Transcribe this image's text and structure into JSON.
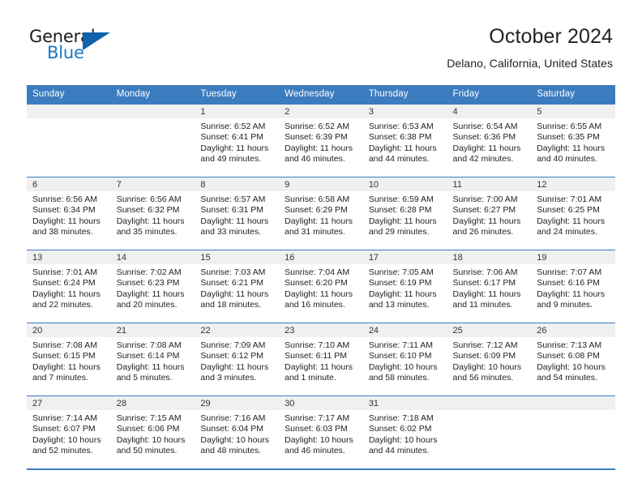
{
  "brand": {
    "name_top": "General",
    "name_bottom": "Blue",
    "color_dark": "#1b1b1b",
    "color_blue": "#1878c4",
    "triangle_color": "#1163ab"
  },
  "header": {
    "title": "October 2024",
    "subtitle": "Delano, California, United States"
  },
  "theme": {
    "header_bg": "#3b7cbf",
    "header_text": "#ffffff",
    "daynum_bg": "#f0f0f0",
    "cell_bg": "#ffffff",
    "body_text": "#1f1f1f"
  },
  "calendar": {
    "weekday_headers": [
      "Sunday",
      "Monday",
      "Tuesday",
      "Wednesday",
      "Thursday",
      "Friday",
      "Saturday"
    ],
    "labels": {
      "sunrise_prefix": "Sunrise:",
      "sunset_prefix": "Sunset:",
      "daylight_prefix": "Daylight:"
    },
    "weeks": [
      [
        {
          "empty": true
        },
        {
          "empty": true
        },
        {
          "day": "1",
          "sunrise": "Sunrise: 6:52 AM",
          "sunset": "Sunset: 6:41 PM",
          "daylight": "Daylight: 11 hours and 49 minutes."
        },
        {
          "day": "2",
          "sunrise": "Sunrise: 6:52 AM",
          "sunset": "Sunset: 6:39 PM",
          "daylight": "Daylight: 11 hours and 46 minutes."
        },
        {
          "day": "3",
          "sunrise": "Sunrise: 6:53 AM",
          "sunset": "Sunset: 6:38 PM",
          "daylight": "Daylight: 11 hours and 44 minutes."
        },
        {
          "day": "4",
          "sunrise": "Sunrise: 6:54 AM",
          "sunset": "Sunset: 6:36 PM",
          "daylight": "Daylight: 11 hours and 42 minutes."
        },
        {
          "day": "5",
          "sunrise": "Sunrise: 6:55 AM",
          "sunset": "Sunset: 6:35 PM",
          "daylight": "Daylight: 11 hours and 40 minutes."
        }
      ],
      [
        {
          "day": "6",
          "sunrise": "Sunrise: 6:56 AM",
          "sunset": "Sunset: 6:34 PM",
          "daylight": "Daylight: 11 hours and 38 minutes."
        },
        {
          "day": "7",
          "sunrise": "Sunrise: 6:56 AM",
          "sunset": "Sunset: 6:32 PM",
          "daylight": "Daylight: 11 hours and 35 minutes."
        },
        {
          "day": "8",
          "sunrise": "Sunrise: 6:57 AM",
          "sunset": "Sunset: 6:31 PM",
          "daylight": "Daylight: 11 hours and 33 minutes."
        },
        {
          "day": "9",
          "sunrise": "Sunrise: 6:58 AM",
          "sunset": "Sunset: 6:29 PM",
          "daylight": "Daylight: 11 hours and 31 minutes."
        },
        {
          "day": "10",
          "sunrise": "Sunrise: 6:59 AM",
          "sunset": "Sunset: 6:28 PM",
          "daylight": "Daylight: 11 hours and 29 minutes."
        },
        {
          "day": "11",
          "sunrise": "Sunrise: 7:00 AM",
          "sunset": "Sunset: 6:27 PM",
          "daylight": "Daylight: 11 hours and 26 minutes."
        },
        {
          "day": "12",
          "sunrise": "Sunrise: 7:01 AM",
          "sunset": "Sunset: 6:25 PM",
          "daylight": "Daylight: 11 hours and 24 minutes."
        }
      ],
      [
        {
          "day": "13",
          "sunrise": "Sunrise: 7:01 AM",
          "sunset": "Sunset: 6:24 PM",
          "daylight": "Daylight: 11 hours and 22 minutes."
        },
        {
          "day": "14",
          "sunrise": "Sunrise: 7:02 AM",
          "sunset": "Sunset: 6:23 PM",
          "daylight": "Daylight: 11 hours and 20 minutes."
        },
        {
          "day": "15",
          "sunrise": "Sunrise: 7:03 AM",
          "sunset": "Sunset: 6:21 PM",
          "daylight": "Daylight: 11 hours and 18 minutes."
        },
        {
          "day": "16",
          "sunrise": "Sunrise: 7:04 AM",
          "sunset": "Sunset: 6:20 PM",
          "daylight": "Daylight: 11 hours and 16 minutes."
        },
        {
          "day": "17",
          "sunrise": "Sunrise: 7:05 AM",
          "sunset": "Sunset: 6:19 PM",
          "daylight": "Daylight: 11 hours and 13 minutes."
        },
        {
          "day": "18",
          "sunrise": "Sunrise: 7:06 AM",
          "sunset": "Sunset: 6:17 PM",
          "daylight": "Daylight: 11 hours and 11 minutes."
        },
        {
          "day": "19",
          "sunrise": "Sunrise: 7:07 AM",
          "sunset": "Sunset: 6:16 PM",
          "daylight": "Daylight: 11 hours and 9 minutes."
        }
      ],
      [
        {
          "day": "20",
          "sunrise": "Sunrise: 7:08 AM",
          "sunset": "Sunset: 6:15 PM",
          "daylight": "Daylight: 11 hours and 7 minutes."
        },
        {
          "day": "21",
          "sunrise": "Sunrise: 7:08 AM",
          "sunset": "Sunset: 6:14 PM",
          "daylight": "Daylight: 11 hours and 5 minutes."
        },
        {
          "day": "22",
          "sunrise": "Sunrise: 7:09 AM",
          "sunset": "Sunset: 6:12 PM",
          "daylight": "Daylight: 11 hours and 3 minutes."
        },
        {
          "day": "23",
          "sunrise": "Sunrise: 7:10 AM",
          "sunset": "Sunset: 6:11 PM",
          "daylight": "Daylight: 11 hours and 1 minute."
        },
        {
          "day": "24",
          "sunrise": "Sunrise: 7:11 AM",
          "sunset": "Sunset: 6:10 PM",
          "daylight": "Daylight: 10 hours and 58 minutes."
        },
        {
          "day": "25",
          "sunrise": "Sunrise: 7:12 AM",
          "sunset": "Sunset: 6:09 PM",
          "daylight": "Daylight: 10 hours and 56 minutes."
        },
        {
          "day": "26",
          "sunrise": "Sunrise: 7:13 AM",
          "sunset": "Sunset: 6:08 PM",
          "daylight": "Daylight: 10 hours and 54 minutes."
        }
      ],
      [
        {
          "day": "27",
          "sunrise": "Sunrise: 7:14 AM",
          "sunset": "Sunset: 6:07 PM",
          "daylight": "Daylight: 10 hours and 52 minutes."
        },
        {
          "day": "28",
          "sunrise": "Sunrise: 7:15 AM",
          "sunset": "Sunset: 6:06 PM",
          "daylight": "Daylight: 10 hours and 50 minutes."
        },
        {
          "day": "29",
          "sunrise": "Sunrise: 7:16 AM",
          "sunset": "Sunset: 6:04 PM",
          "daylight": "Daylight: 10 hours and 48 minutes."
        },
        {
          "day": "30",
          "sunrise": "Sunrise: 7:17 AM",
          "sunset": "Sunset: 6:03 PM",
          "daylight": "Daylight: 10 hours and 46 minutes."
        },
        {
          "day": "31",
          "sunrise": "Sunrise: 7:18 AM",
          "sunset": "Sunset: 6:02 PM",
          "daylight": "Daylight: 10 hours and 44 minutes."
        },
        {
          "empty": true
        },
        {
          "empty": true
        }
      ]
    ]
  }
}
